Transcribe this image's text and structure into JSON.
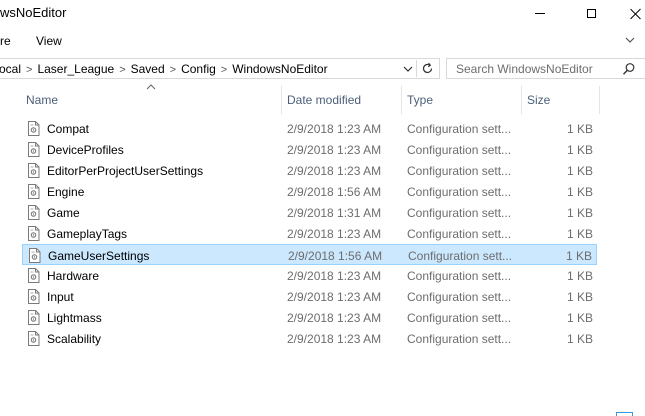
{
  "window": {
    "title": "wsNoEditor"
  },
  "ribbon": {
    "tabs": [
      "re",
      "View"
    ]
  },
  "address": {
    "crumbs": [
      "ocal",
      "Laser_League",
      "Saved",
      "Config",
      "WindowsNoEditor"
    ],
    "separator": ">"
  },
  "search": {
    "placeholder": "Search WindowsNoEditor"
  },
  "columns": {
    "name": "Name",
    "date": "Date modified",
    "type": "Type",
    "size": "Size"
  },
  "files": [
    {
      "name": "Compat",
      "date": "2/9/2018 1:23 AM",
      "type": "Configuration sett...",
      "size": "1 KB"
    },
    {
      "name": "DeviceProfiles",
      "date": "2/9/2018 1:23 AM",
      "type": "Configuration sett...",
      "size": "1 KB"
    },
    {
      "name": "EditorPerProjectUserSettings",
      "date": "2/9/2018 1:23 AM",
      "type": "Configuration sett...",
      "size": "1 KB"
    },
    {
      "name": "Engine",
      "date": "2/9/2018 1:56 AM",
      "type": "Configuration sett...",
      "size": "1 KB"
    },
    {
      "name": "Game",
      "date": "2/9/2018 1:31 AM",
      "type": "Configuration sett...",
      "size": "1 KB"
    },
    {
      "name": "GameplayTags",
      "date": "2/9/2018 1:23 AM",
      "type": "Configuration sett...",
      "size": "1 KB"
    },
    {
      "name": "GameUserSettings",
      "date": "2/9/2018 1:56 AM",
      "type": "Configuration sett...",
      "size": "1 KB",
      "selected": true
    },
    {
      "name": "Hardware",
      "date": "2/9/2018 1:23 AM",
      "type": "Configuration sett...",
      "size": "1 KB"
    },
    {
      "name": "Input",
      "date": "2/9/2018 1:23 AM",
      "type": "Configuration sett...",
      "size": "1 KB"
    },
    {
      "name": "Lightmass",
      "date": "2/9/2018 1:23 AM",
      "type": "Configuration sett...",
      "size": "1 KB"
    },
    {
      "name": "Scalability",
      "date": "2/9/2018 1:23 AM",
      "type": "Configuration sett...",
      "size": "1 KB"
    }
  ],
  "colors": {
    "selected_bg": "#cce8ff",
    "selected_border": "#99d1ff",
    "header_text": "#4c607a",
    "secondary_text": "#6d6d6d"
  },
  "icons": {
    "file": "config-file-icon",
    "search": "search-icon",
    "refresh": "refresh-icon"
  }
}
